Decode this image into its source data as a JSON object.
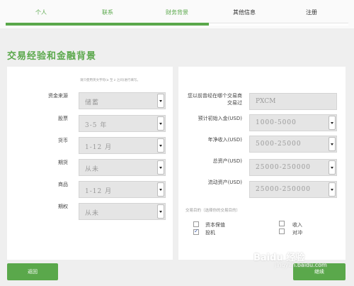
{
  "steps": [
    {
      "label": "个人",
      "state": "done"
    },
    {
      "label": "联系",
      "state": "done"
    },
    {
      "label": "财务背景",
      "state": "current"
    },
    {
      "label": "其他信息",
      "state": "todo"
    },
    {
      "label": "注册",
      "state": "todo"
    }
  ],
  "colors": {
    "accent": "#5aa84b"
  },
  "heading": "交易经验和金融背景",
  "left": {
    "hint": "请只使用英文字符(a 至 z 之间)进行填写。",
    "rows": [
      {
        "label": "资金来源",
        "value": "储蓄"
      },
      {
        "label": "股票",
        "value": "3-5 年"
      },
      {
        "label": "货币",
        "value": "1-12 月"
      },
      {
        "label": "期货",
        "value": "从未"
      },
      {
        "label": "商品",
        "value": "1-12 月"
      },
      {
        "label": "期权",
        "value": "从未"
      }
    ]
  },
  "right": {
    "broker": {
      "label_line1": "您以前曾经在哪个交易商",
      "label_line2": "交易过",
      "value": "PXCM"
    },
    "rows": [
      {
        "label": "预计初始入金(USD)",
        "value": "1000-5000"
      },
      {
        "label": "年净收入(USD)",
        "value": "5000-25000"
      },
      {
        "label": "总资产(USD)",
        "value": "25000-250000"
      },
      {
        "label": "流动资产(USD)",
        "value": "25000-250000"
      }
    ],
    "purpose_label": "交易目的（选择你的交易目的）",
    "purposes": [
      {
        "label": "资本保值",
        "checked": false
      },
      {
        "label": "收入",
        "checked": false
      },
      {
        "label": "投机",
        "checked": true
      },
      {
        "label": "对冲",
        "checked": false
      }
    ]
  },
  "buttons": {
    "back": "返回",
    "next": "继续"
  },
  "watermark": {
    "line1": "Baidu 经验",
    "line2": "jingyan.baidu.com"
  }
}
